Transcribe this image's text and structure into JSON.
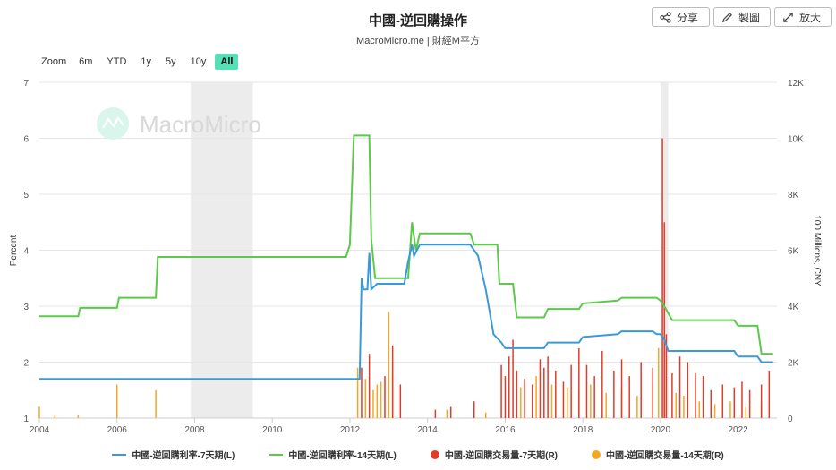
{
  "header": {
    "title": "中國-逆回購操作",
    "subtitle": "MacroMicro.me | 財經M平方"
  },
  "toolbar": {
    "share_label": "分享",
    "edit_label": "製圖",
    "expand_label": "放大"
  },
  "zoom": {
    "label": "Zoom",
    "options": [
      "6m",
      "YTD",
      "1y",
      "5y",
      "10y",
      "All"
    ],
    "selected": "All"
  },
  "watermark": "MacroMicro",
  "colors": {
    "rate7": "#3a9ad9",
    "rate14": "#5cc94a",
    "vol7": "#e03c2a",
    "vol14": "#f5a623",
    "recession": "#ececec",
    "accent": "#56e0b8"
  },
  "chart_data": {
    "type": "line",
    "ylabel_left": "Percent",
    "ylabel_right": "100 Millions, CNY",
    "x_ticks": [
      "2004",
      "2006",
      "2008",
      "2010",
      "2012",
      "2014",
      "2016",
      "2018",
      "2020",
      "2022"
    ],
    "y_left_ticks": [
      "1",
      "2",
      "3",
      "4",
      "5",
      "6",
      "7"
    ],
    "y_right_ticks": [
      "0",
      "2K",
      "4K",
      "6K",
      "8K",
      "10K",
      "12K"
    ],
    "ylim_left": [
      1,
      7
    ],
    "ylim_right": [
      0,
      12000
    ],
    "xlim": [
      2004.0,
      2023.0
    ],
    "shaded_periods": [
      [
        2007.9,
        2009.5
      ],
      [
        2020.0,
        2020.2
      ]
    ],
    "series": [
      {
        "name": "中國-逆回購利率-7天期(L)",
        "axis": "left",
        "kind": "line",
        "points": [
          [
            2004.0,
            1.7
          ],
          [
            2012.25,
            1.7
          ],
          [
            2012.3,
            3.5
          ],
          [
            2012.35,
            3.3
          ],
          [
            2012.45,
            3.3
          ],
          [
            2012.5,
            3.95
          ],
          [
            2012.55,
            3.3
          ],
          [
            2012.7,
            3.4
          ],
          [
            2013.4,
            3.4
          ],
          [
            2013.5,
            3.8
          ],
          [
            2013.6,
            4.1
          ],
          [
            2013.65,
            3.9
          ],
          [
            2013.8,
            4.1
          ],
          [
            2015.1,
            4.1
          ],
          [
            2015.3,
            3.9
          ],
          [
            2015.5,
            3.3
          ],
          [
            2015.7,
            2.5
          ],
          [
            2015.9,
            2.35
          ],
          [
            2016.0,
            2.25
          ],
          [
            2017.0,
            2.25
          ],
          [
            2017.1,
            2.35
          ],
          [
            2017.9,
            2.35
          ],
          [
            2018.0,
            2.45
          ],
          [
            2018.9,
            2.5
          ],
          [
            2019.0,
            2.55
          ],
          [
            2019.8,
            2.55
          ],
          [
            2019.9,
            2.5
          ],
          [
            2020.0,
            2.5
          ],
          [
            2020.1,
            2.4
          ],
          [
            2020.2,
            2.2
          ],
          [
            2021.9,
            2.2
          ],
          [
            2022.0,
            2.1
          ],
          [
            2022.5,
            2.1
          ],
          [
            2022.6,
            2.0
          ],
          [
            2022.9,
            2.0
          ]
        ]
      },
      {
        "name": "中國-逆回購利率-14天期(L)",
        "axis": "left",
        "kind": "line",
        "points": [
          [
            2004.0,
            2.82
          ],
          [
            2005.0,
            2.82
          ],
          [
            2005.05,
            2.97
          ],
          [
            2006.0,
            2.97
          ],
          [
            2006.05,
            3.15
          ],
          [
            2007.0,
            3.15
          ],
          [
            2007.05,
            3.88
          ],
          [
            2011.9,
            3.88
          ],
          [
            2012.0,
            4.1
          ],
          [
            2012.1,
            6.05
          ],
          [
            2012.5,
            6.05
          ],
          [
            2012.55,
            4.2
          ],
          [
            2012.65,
            3.5
          ],
          [
            2013.5,
            3.5
          ],
          [
            2013.6,
            4.5
          ],
          [
            2013.7,
            4.0
          ],
          [
            2013.8,
            4.3
          ],
          [
            2015.1,
            4.3
          ],
          [
            2015.2,
            4.1
          ],
          [
            2015.8,
            4.1
          ],
          [
            2015.85,
            3.4
          ],
          [
            2016.2,
            3.4
          ],
          [
            2016.3,
            2.8
          ],
          [
            2017.0,
            2.8
          ],
          [
            2017.1,
            2.95
          ],
          [
            2017.9,
            2.95
          ],
          [
            2018.0,
            3.05
          ],
          [
            2018.9,
            3.1
          ],
          [
            2019.0,
            3.15
          ],
          [
            2019.9,
            3.15
          ],
          [
            2020.0,
            3.1
          ],
          [
            2020.1,
            3.0
          ],
          [
            2020.3,
            2.75
          ],
          [
            2021.9,
            2.75
          ],
          [
            2022.0,
            2.65
          ],
          [
            2022.5,
            2.65
          ],
          [
            2022.6,
            2.15
          ],
          [
            2022.9,
            2.15
          ]
        ]
      },
      {
        "name": "中國-逆回購交易量-7天期(R)",
        "axis": "right",
        "kind": "spikes",
        "points": [
          [
            2012.3,
            1800
          ],
          [
            2012.5,
            2300
          ],
          [
            2012.9,
            1500
          ],
          [
            2013.1,
            2600
          ],
          [
            2013.3,
            1200
          ],
          [
            2014.2,
            300
          ],
          [
            2014.6,
            400
          ],
          [
            2015.2,
            600
          ],
          [
            2015.9,
            1900
          ],
          [
            2016.0,
            1500
          ],
          [
            2016.1,
            2200
          ],
          [
            2016.2,
            2800
          ],
          [
            2016.3,
            1700
          ],
          [
            2016.5,
            1400
          ],
          [
            2016.7,
            1200
          ],
          [
            2016.9,
            2100
          ],
          [
            2017.0,
            1800
          ],
          [
            2017.1,
            2200
          ],
          [
            2017.3,
            1700
          ],
          [
            2017.5,
            1300
          ],
          [
            2017.7,
            1900
          ],
          [
            2017.9,
            2500
          ],
          [
            2018.1,
            1900
          ],
          [
            2018.3,
            1500
          ],
          [
            2018.5,
            2400
          ],
          [
            2018.8,
            1700
          ],
          [
            2019.0,
            2100
          ],
          [
            2019.2,
            1500
          ],
          [
            2019.5,
            2000
          ],
          [
            2019.8,
            1800
          ],
          [
            2020.05,
            10000
          ],
          [
            2020.1,
            7000
          ],
          [
            2020.15,
            3000
          ],
          [
            2020.3,
            1600
          ],
          [
            2020.5,
            2200
          ],
          [
            2020.7,
            2000
          ],
          [
            2020.9,
            1600
          ],
          [
            2021.1,
            1500
          ],
          [
            2021.3,
            1000
          ],
          [
            2021.6,
            1200
          ],
          [
            2021.9,
            1100
          ],
          [
            2022.1,
            1300
          ],
          [
            2022.3,
            1000
          ],
          [
            2022.6,
            1200
          ],
          [
            2022.8,
            1700
          ]
        ]
      },
      {
        "name": "中國-逆回購交易量-14天期(R)",
        "axis": "right",
        "kind": "spikes",
        "points": [
          [
            2004.0,
            400
          ],
          [
            2004.4,
            100
          ],
          [
            2005.0,
            100
          ],
          [
            2006.0,
            1200
          ],
          [
            2007.0,
            1000
          ],
          [
            2012.2,
            1800
          ],
          [
            2012.4,
            1400
          ],
          [
            2012.6,
            1000
          ],
          [
            2012.7,
            1200
          ],
          [
            2012.8,
            1300
          ],
          [
            2013.0,
            3800
          ],
          [
            2013.1,
            2000
          ],
          [
            2014.5,
            300
          ],
          [
            2015.5,
            200
          ],
          [
            2016.1,
            1400
          ],
          [
            2016.4,
            1100
          ],
          [
            2016.8,
            1500
          ],
          [
            2017.2,
            1200
          ],
          [
            2017.6,
            1100
          ],
          [
            2017.9,
            1000
          ],
          [
            2018.2,
            1200
          ],
          [
            2018.6,
            900
          ],
          [
            2019.0,
            1100
          ],
          [
            2019.4,
            800
          ],
          [
            2019.8,
            1200
          ],
          [
            2019.95,
            2500
          ],
          [
            2020.1,
            1500
          ],
          [
            2020.4,
            900
          ],
          [
            2020.6,
            800
          ],
          [
            2021.0,
            600
          ],
          [
            2021.4,
            500
          ],
          [
            2021.8,
            600
          ],
          [
            2022.2,
            400
          ],
          [
            2022.6,
            500
          ]
        ]
      }
    ]
  }
}
